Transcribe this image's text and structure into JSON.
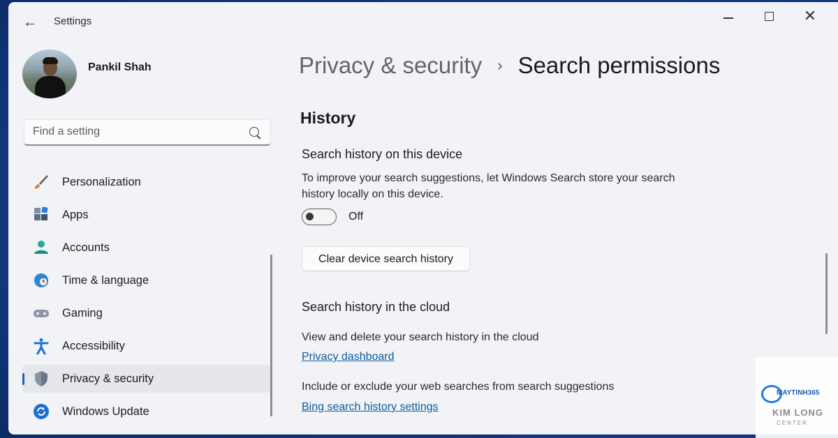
{
  "window": {
    "title": "Settings",
    "back_icon": "arrow-left-icon",
    "minimize_icon": "minimize-icon",
    "maximize_icon": "maximize-icon",
    "close_icon": "close-icon"
  },
  "profile": {
    "name": "Pankil Shah"
  },
  "search": {
    "placeholder": "Find a setting",
    "icon": "search-icon"
  },
  "sidebar": {
    "items": [
      {
        "label": "Personalization",
        "icon": "paintbrush-icon",
        "active": false
      },
      {
        "label": "Apps",
        "icon": "apps-icon",
        "active": false
      },
      {
        "label": "Accounts",
        "icon": "person-icon",
        "active": false
      },
      {
        "label": "Time & language",
        "icon": "globe-clock-icon",
        "active": false
      },
      {
        "label": "Gaming",
        "icon": "gamepad-icon",
        "active": false
      },
      {
        "label": "Accessibility",
        "icon": "accessibility-icon",
        "active": false
      },
      {
        "label": "Privacy & security",
        "icon": "shield-icon",
        "active": true
      },
      {
        "label": "Windows Update",
        "icon": "update-icon",
        "active": false
      }
    ]
  },
  "main": {
    "breadcrumb": {
      "parent": "Privacy & security",
      "separator": "›",
      "current": "Search permissions"
    },
    "section_title": "History",
    "device_history": {
      "title": "Search history on this device",
      "description": "To improve your search suggestions, let Windows Search store your search history locally on this device.",
      "toggle_state": "Off",
      "clear_button": "Clear device search history"
    },
    "cloud_history": {
      "title": "Search history in the cloud",
      "description": "View and delete your search history in the cloud",
      "dashboard_link": "Privacy dashboard",
      "description2": "Include or exclude your web searches from search suggestions",
      "bing_link": "Bing search history settings"
    }
  },
  "watermark": {
    "brand": "MAYTINH365",
    "line1": "KIM LONG",
    "line2": "CENTER"
  },
  "colors": {
    "window_bg": "#f2f3f7",
    "accent": "#1f5fbf",
    "link": "#0f5b9c"
  }
}
